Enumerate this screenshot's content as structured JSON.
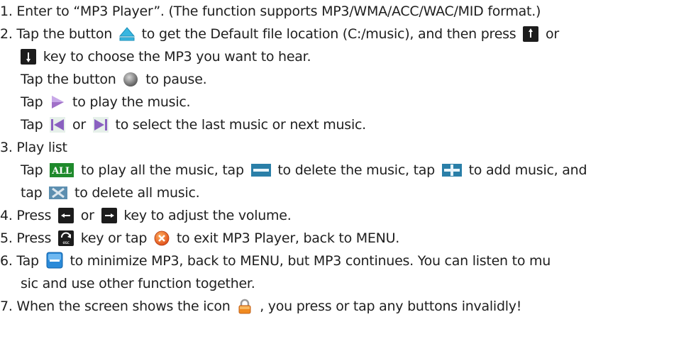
{
  "instructions": {
    "l1": "1. Enter to “MP3 Player”. (The function supports MP3/WMA/ACC/WAC/MID format.)",
    "l2a": "2. Tap the button",
    "l2b": "to get the Default file location (C:/music), and then press",
    "l2c": "or",
    "l3": "key to choose the MP3 you want to hear.",
    "l4a": "Tap the button",
    "l4b": "to pause.",
    "l5a": "Tap",
    "l5b": "to play the music.",
    "l6a": "Tap",
    "l6b": "or",
    "l6c": "to select the last music or next music.",
    "l7": "3. Play list",
    "l8a": "Tap",
    "l8b": "to play all the music, tap",
    "l8c": "to delete the music, tap",
    "l8d": "to add music, and",
    "l9a": "tap",
    "l9b": "to delete all music.",
    "l10a": "4. Press",
    "l10b": "or",
    "l10c": "key to adjust the volume.",
    "l11a": "5. Press",
    "l11b": "key or tap",
    "l11c": "to exit MP3 Player, back to MENU.",
    "l12a": "6. Tap",
    "l12b": "to minimize MP3, back to MENU, but MP3 continues. You can listen to mu",
    "l13": "sic and use other function together.",
    "l14a": "7. When the screen shows the icon",
    "l14b": ", you press or tap any buttons invalidly!",
    "all_icon_text": "ALL",
    "esc_icon_text": "esc"
  },
  "icons": [
    "eject-icon",
    "up-arrow-key-icon",
    "down-arrow-key-icon",
    "pause-icon",
    "play-icon",
    "previous-icon",
    "next-icon",
    "all-icon",
    "minus-icon",
    "plus-icon",
    "delete-all-icon",
    "left-arrow-key-icon",
    "right-arrow-key-icon",
    "esc-key-icon",
    "exit-icon",
    "minimize-icon",
    "lock-icon"
  ]
}
